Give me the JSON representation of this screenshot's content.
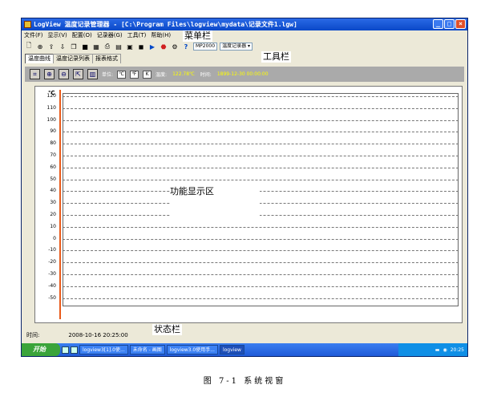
{
  "window": {
    "title": "LogView 温度记录管理器 - [C:\\Program Files\\logview\\mydata\\记录文件1.lgw]",
    "controls": [
      "_",
      "□",
      "×"
    ]
  },
  "menu": [
    "文件(F)",
    "显示(V)",
    "配置(O)",
    "记录器(G)",
    "工具(T)",
    "帮助(H)"
  ],
  "toolbar": {
    "device": "MP2000",
    "device_type": "温度记录器"
  },
  "tabs": [
    "温度曲线",
    "温度记录列表",
    "报表格式"
  ],
  "controls": {
    "unit_label": "单位:",
    "unit_c": "℃",
    "unit_f": "℉",
    "unit_k": "K",
    "temp_label": "温度:",
    "temp_value": "122.78℃",
    "time_label": "时间:",
    "time_value": "1899-12-30 00:00:00"
  },
  "chart": {
    "unit": "℃",
    "y_ticks": [
      "120",
      "110",
      "100",
      "90",
      "80",
      "70",
      "60",
      "50",
      "40",
      "30",
      "20",
      "10",
      "0",
      "-10",
      "-20",
      "-30",
      "-40",
      "-50"
    ]
  },
  "status": {
    "time_label": "时间:",
    "time_value": "2008-10-16 20:25:00"
  },
  "annotations": {
    "menu": "菜单栏",
    "toolbar": "工具栏",
    "function": "功能显示区",
    "status": "状态栏"
  },
  "taskbar": {
    "start": "开始",
    "tasks": [
      "logview3[1].0使...",
      "未命名 - 画图",
      "logview3.0使用手...",
      "logview"
    ],
    "clock": "20:25"
  },
  "caption": "图 7-1  系统视窗"
}
